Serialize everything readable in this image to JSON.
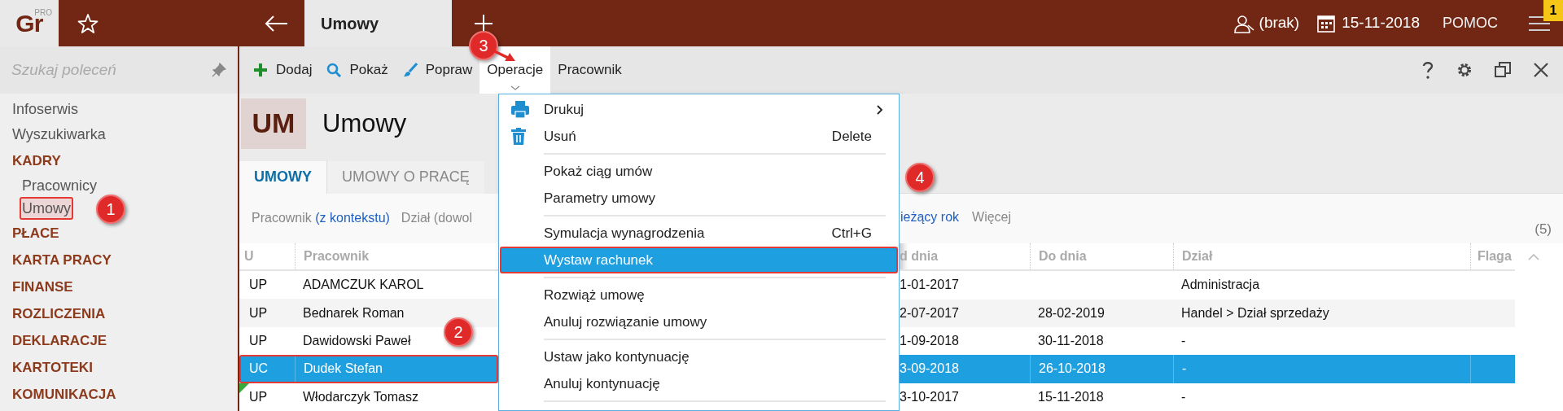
{
  "app_bar": {
    "logo": "Gr",
    "logo_badge": "PRO",
    "tab_title": "Umowy",
    "user": "(brak)",
    "date": "15-11-2018",
    "help": "POMOC",
    "notification_count": "1"
  },
  "sidebar": {
    "search_placeholder": "Szukaj poleceń",
    "items": [
      {
        "label": "Infoserwis",
        "kind": "link",
        "selected": false,
        "outlined": false
      },
      {
        "label": "Wyszukiwarka",
        "kind": "link",
        "selected": false,
        "outlined": false
      },
      {
        "label": "KADRY",
        "kind": "section",
        "selected": false,
        "outlined": false
      },
      {
        "label": "Pracownicy",
        "kind": "subitem",
        "selected": false,
        "outlined": false
      },
      {
        "label": "Umowy",
        "kind": "subitem",
        "selected": true,
        "outlined": true
      },
      {
        "label": "PŁACE",
        "kind": "section",
        "selected": false,
        "outlined": false
      },
      {
        "label": "KARTA PRACY",
        "kind": "section",
        "selected": false,
        "outlined": false
      },
      {
        "label": "FINANSE",
        "kind": "section",
        "selected": false,
        "outlined": false
      },
      {
        "label": "ROZLICZENIA",
        "kind": "section",
        "selected": false,
        "outlined": false
      },
      {
        "label": "DEKLARACJE",
        "kind": "section",
        "selected": false,
        "outlined": false
      },
      {
        "label": "KARTOTEKI",
        "kind": "section",
        "selected": false,
        "outlined": false
      },
      {
        "label": "KOMUNIKACJA",
        "kind": "section",
        "selected": false,
        "outlined": false
      }
    ]
  },
  "toolbar": {
    "buttons": [
      {
        "label": "Dodaj",
        "kind": "add",
        "selected": false
      },
      {
        "label": "Pokaż",
        "kind": "view",
        "selected": false
      },
      {
        "label": "Popraw",
        "kind": "edit",
        "selected": false
      },
      {
        "label": "Operacje",
        "kind": "dropdown",
        "selected": true
      },
      {
        "label": "Pracownik",
        "kind": "text",
        "selected": false
      }
    ]
  },
  "page_header": {
    "badge": "UM",
    "title": "Umowy"
  },
  "tabs": [
    {
      "label": "UMOWY",
      "selected": true
    },
    {
      "label": "UMOWY O PRACĘ",
      "selected": false
    }
  ],
  "filters_left": [
    {
      "label": "Pracownik",
      "value": "(z kontekstu)"
    },
    {
      "label": "Dział (dowol"
    }
  ],
  "filters_right": [
    {
      "value": "ieżący rok"
    },
    {
      "label": "Więcej"
    }
  ],
  "count": "(5)",
  "table": {
    "columns_left": [
      "U",
      "Pracownik"
    ],
    "columns_right": [
      "d dnia",
      "Do dnia",
      "Dział",
      "Flaga"
    ],
    "rows": [
      {
        "u": "UP",
        "pracownik": "ADAMCZUK KAROL",
        "od": "1-01-2017",
        "do": "",
        "dzial": "Administracja",
        "selected": false,
        "outlined": false,
        "marked": false
      },
      {
        "u": "UP",
        "pracownik": "Bednarek Roman",
        "od": "2-07-2017",
        "do": "28-02-2019",
        "dzial": "Handel > Dział sprzedaży",
        "selected": false,
        "outlined": false,
        "marked": false
      },
      {
        "u": "UP",
        "pracownik": "Dawidowski Paweł",
        "od": "1-09-2018",
        "do": "30-11-2018",
        "dzial": "-",
        "selected": false,
        "outlined": false,
        "marked": false
      },
      {
        "u": "UC",
        "pracownik": "Dudek Stefan",
        "od": "3-09-2018",
        "do": "26-10-2018",
        "dzial": "-",
        "selected": true,
        "outlined": true,
        "marked": false
      },
      {
        "u": "UP",
        "pracownik": "Włodarczyk Tomasz",
        "od": "3-10-2017",
        "do": "15-11-2018",
        "dzial": "-",
        "selected": false,
        "outlined": false,
        "marked": true
      }
    ]
  },
  "menu": [
    {
      "kind": "item",
      "label": "Drukuj",
      "submenu": true,
      "selected": false,
      "outlined": false
    },
    {
      "kind": "item",
      "label": "Usuń",
      "shortcut": "Delete",
      "selected": false,
      "outlined": false
    },
    {
      "kind": "separator"
    },
    {
      "kind": "item",
      "label": "Pokaż ciąg umów",
      "selected": false,
      "outlined": false
    },
    {
      "kind": "item",
      "label": "Parametry umowy",
      "selected": false,
      "outlined": false
    },
    {
      "kind": "separator"
    },
    {
      "kind": "item",
      "label": "Symulacja wynagrodzenia",
      "shortcut": "Ctrl+G",
      "selected": false,
      "outlined": false
    },
    {
      "kind": "item",
      "label": "Wystaw rachunek",
      "selected": true,
      "outlined": true
    },
    {
      "kind": "separator"
    },
    {
      "kind": "item",
      "label": "Rozwiąż umowę",
      "selected": false,
      "outlined": false
    },
    {
      "kind": "item",
      "label": "Anuluj rozwiązanie umowy",
      "selected": false,
      "outlined": false
    },
    {
      "kind": "separator"
    },
    {
      "kind": "item",
      "label": "Ustaw jako kontynuację",
      "selected": false,
      "outlined": false
    },
    {
      "kind": "item",
      "label": "Anuluj kontynuację",
      "selected": false,
      "outlined": false
    },
    {
      "kind": "separator"
    }
  ],
  "annotations": [
    "1",
    "2",
    "3",
    "4"
  ]
}
